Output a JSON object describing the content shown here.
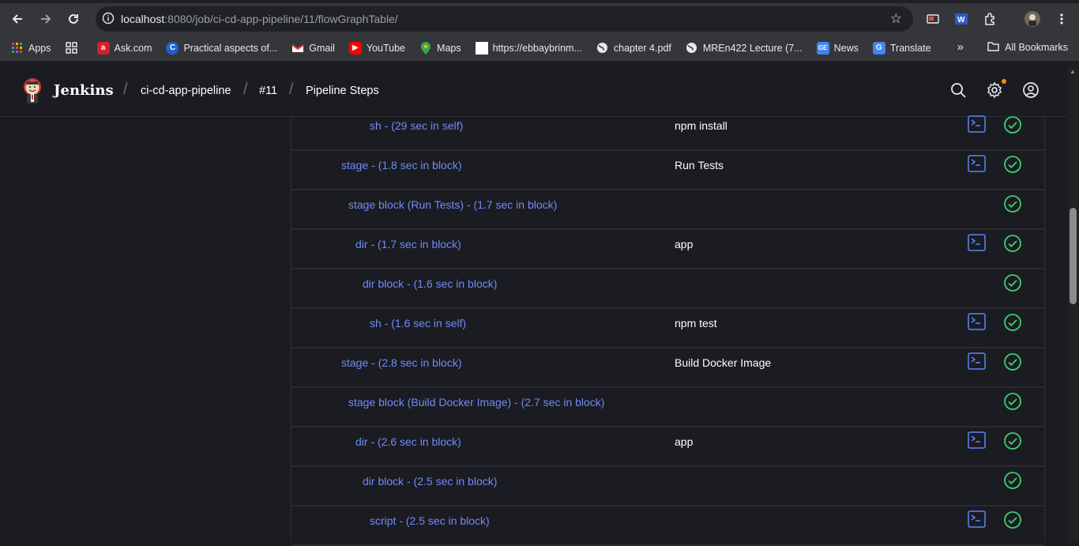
{
  "browser": {
    "url_host": "localhost",
    "url_rest": ":8080/job/ci-cd-app-pipeline/11/flowGraphTable/",
    "bookmarks": [
      {
        "label": "Apps",
        "icon": "apps-grid-icon"
      },
      {
        "label": "",
        "icon": "grid-icon"
      },
      {
        "label": "Ask.com",
        "icon": "ask-icon"
      },
      {
        "label": "Practical aspects of...",
        "icon": "coursera-icon"
      },
      {
        "label": "Gmail",
        "icon": "gmail-icon"
      },
      {
        "label": "YouTube",
        "icon": "youtube-icon"
      },
      {
        "label": "Maps",
        "icon": "maps-icon"
      },
      {
        "label": "https://ebbaybrinm...",
        "icon": "page-icon"
      },
      {
        "label": "chapter 4.pdf",
        "icon": "globe-icon"
      },
      {
        "label": "MREn422 Lecture (7...",
        "icon": "globe-icon"
      },
      {
        "label": "News",
        "icon": "news-icon"
      },
      {
        "label": "Translate",
        "icon": "translate-icon"
      }
    ],
    "all_bookmarks": "All Bookmarks"
  },
  "jenkins": {
    "brand": "Jenkins",
    "breadcrumbs": [
      "ci-cd-app-pipeline",
      "#11",
      "Pipeline Steps"
    ]
  },
  "rows": [
    {
      "step": "sh - (29 sec in self)",
      "arg": "npm install",
      "console": true,
      "depth": 3
    },
    {
      "step": "stage - (1.8 sec in block)",
      "arg": "Run Tests",
      "console": true,
      "depth": 1
    },
    {
      "step": "stage block (Run Tests) - (1.7 sec in block)",
      "arg": "",
      "console": false,
      "depth": 1.5
    },
    {
      "step": "dir - (1.7 sec in block)",
      "arg": "app",
      "console": true,
      "depth": 2
    },
    {
      "step": "dir block - (1.6 sec in block)",
      "arg": "",
      "console": false,
      "depth": 2.5
    },
    {
      "step": "sh - (1.6 sec in self)",
      "arg": "npm test",
      "console": true,
      "depth": 3
    },
    {
      "step": "stage - (2.8 sec in block)",
      "arg": "Build Docker Image",
      "console": true,
      "depth": 1
    },
    {
      "step": "stage block (Build Docker Image) - (2.7 sec in block)",
      "arg": "",
      "console": false,
      "depth": 1.5
    },
    {
      "step": "dir - (2.6 sec in block)",
      "arg": "app",
      "console": true,
      "depth": 2
    },
    {
      "step": "dir block - (2.5 sec in block)",
      "arg": "",
      "console": false,
      "depth": 2.5
    },
    {
      "step": "script - (2.5 sec in block)",
      "arg": "",
      "console": true,
      "depth": 3
    }
  ],
  "colors": {
    "link": "#6e8df7",
    "success": "#3ccf6e",
    "console": "#5b87f5"
  }
}
